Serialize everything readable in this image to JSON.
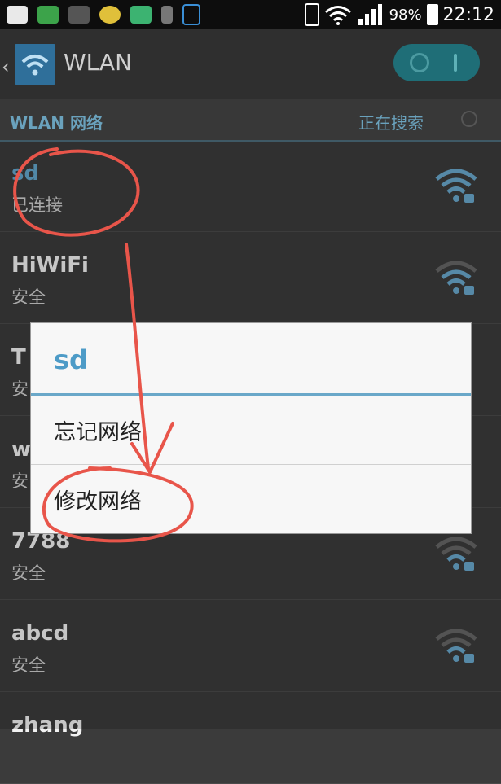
{
  "status_bar": {
    "battery": "98%",
    "time": "22:12",
    "icons": [
      "notification-icon",
      "sim-icon",
      "leaf-icon",
      "app-icon",
      "image-icon",
      "sd-icon",
      "lock-icon",
      "phone-icon",
      "wifi-signal-icon",
      "cell-signal-icon",
      "battery-icon"
    ]
  },
  "action_bar": {
    "title": "WLAN",
    "back_icon": "chevron-left-icon",
    "toggle": {
      "on": true
    }
  },
  "section": {
    "label": "WLAN 网络",
    "status": "正在搜索"
  },
  "networks": [
    {
      "name": "sd",
      "status": "已连接",
      "connected": true
    },
    {
      "name": "HiWiFi",
      "status": "安全"
    },
    {
      "name": "T",
      "status": "安"
    },
    {
      "name": "w",
      "status": "安"
    },
    {
      "name": "7788",
      "status": "安全"
    },
    {
      "name": "abcd",
      "status": "安全"
    },
    {
      "name": "zhang",
      "status": ""
    }
  ],
  "dialog": {
    "title": "sd",
    "items": [
      "忘记网络",
      "修改网络"
    ]
  },
  "colors": {
    "accent": "#4d9bc7",
    "annotation": "#e8554a",
    "toggle": "#1f6e77"
  }
}
